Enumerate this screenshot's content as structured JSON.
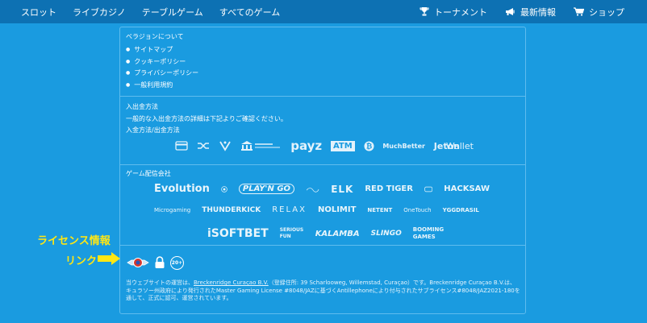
{
  "nav": {
    "left": [
      "スロット",
      "ライブカジノ",
      "テーブルゲーム",
      "すべてのゲーム"
    ],
    "right": [
      {
        "icon": "trophy-icon",
        "label": "トーナメント"
      },
      {
        "icon": "megaphone-icon",
        "label": "最新情報"
      },
      {
        "icon": "cart-icon",
        "label": "ショップ"
      }
    ]
  },
  "about": {
    "title": "ベラジョンについて",
    "links": [
      "サイトマップ",
      "クッキーポリシー",
      "プライバシーポリシー",
      "一般利用規約"
    ]
  },
  "payments": {
    "title": "入出金方法",
    "description": "一般的な入出金方法の詳細は下記よりご確認ください。",
    "subtitle": "入金方法/出金方法",
    "logos": [
      "payz",
      "ATM",
      "MuchBetter",
      "Jeton",
      "Wallet"
    ]
  },
  "providers": {
    "title": "ゲーム配信会社",
    "row1": [
      "Evolution",
      "PLAY'N GO",
      "ELK",
      "RED TIGER",
      "HACKSAW"
    ],
    "row2": [
      "Microgaming",
      "THUNDERKICK",
      "RELAX",
      "NOLIMIT",
      "NETENT",
      "OneTouch",
      "YGGDRASIL"
    ],
    "row3": [
      "iSOFTBET",
      "SERIOUS FUN",
      "KALAMBA",
      "SLINGO",
      "BOOMING GAMES"
    ]
  },
  "license": {
    "age_badge": "20+",
    "text_before": "当ウェブサイトの運営は、",
    "company": "Breckenridge Curaçao B.V.",
    "text_after": "（登録住所: 39 Scharlooweg, Willemstad, Curaçao）です。Breckenridge Curaçao B.V.は、キュラソー州政府により発行されたMaster Gaming License #8048/JAZに基づくAntillephoneにより付与されたサブライセンス#8048/JAZ2021-180を通して、正式に認可、運営されています。"
  },
  "annotations": {
    "line1": "ライセンス情報",
    "line2": "リンク"
  },
  "colors": {
    "background": "#1a9be0",
    "nav": "#0d71b3",
    "highlight": "#ffe713"
  }
}
